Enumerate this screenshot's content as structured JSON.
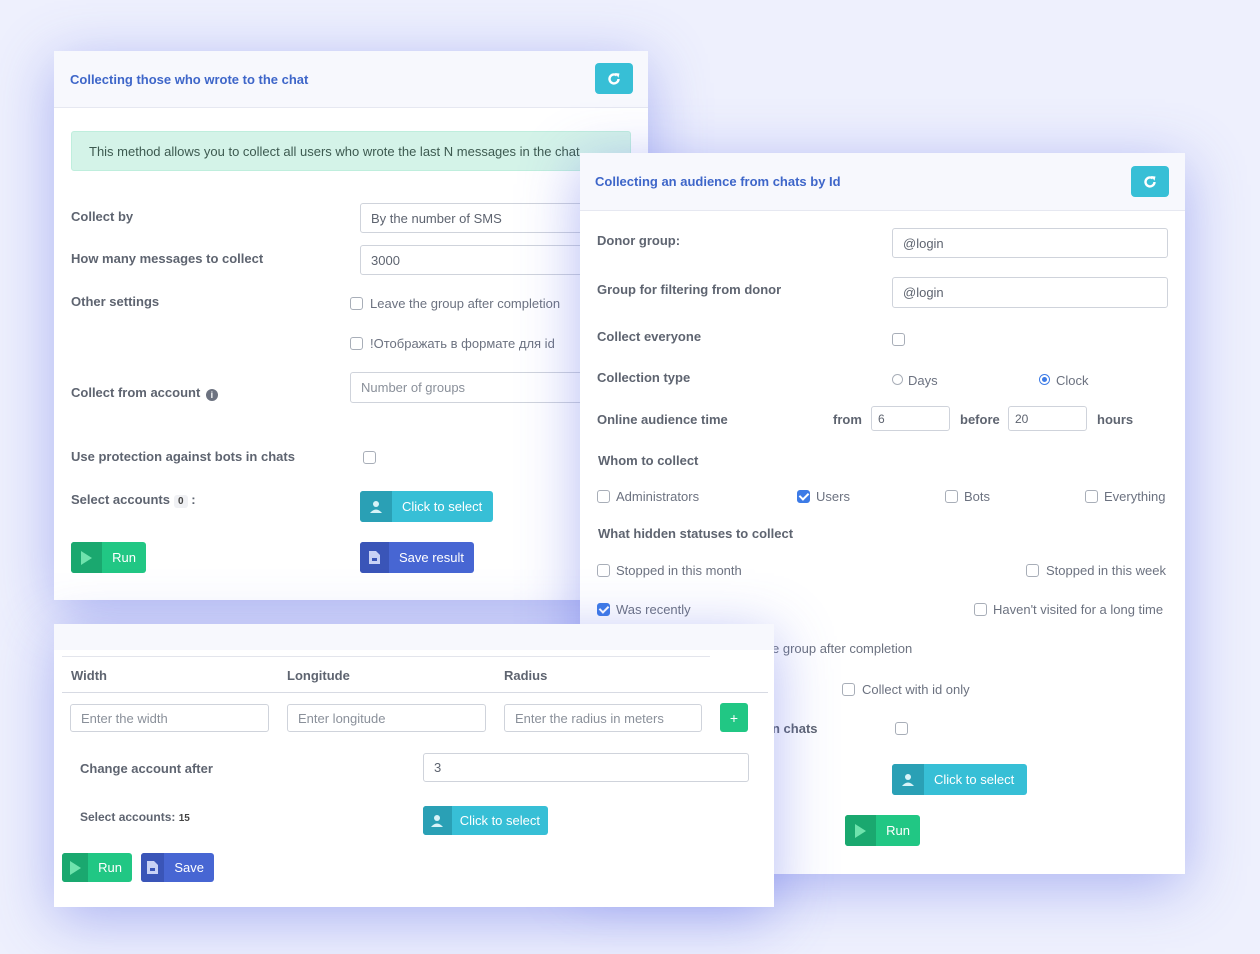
{
  "card1": {
    "title": "Collecting those who wrote to the chat",
    "alert": "This method allows you to collect all users who wrote the last N messages in the chat",
    "collect_by_label": "Collect by",
    "collect_by_value": "By the number of SMS",
    "how_many_label": "How many messages to collect",
    "how_many_value": "3000",
    "other_settings_label": "Other settings",
    "option_leave_group": "Leave the group after completion",
    "option_id_format": "!Отображать в формате для id",
    "collect_from_label": "Collect from account",
    "collect_from_placeholder": "Number of groups",
    "bot_protection_label": "Use protection against bots in chats",
    "select_accounts_label": "Select accounts",
    "select_accounts_count": "0",
    "select_accounts_colon": ":",
    "click_to_select": "Click to select",
    "run": "Run",
    "save_result": "Save result"
  },
  "card2": {
    "title": "Collecting an audience from chats by Id",
    "donor_group_label": "Donor group:",
    "donor_group_value": "@login",
    "filter_group_label": "Group for filtering from donor",
    "filter_group_value": "@login",
    "collect_everyone_label": "Collect everyone",
    "collection_type_label": "Collection type",
    "type_days": "Days",
    "type_clock": "Clock",
    "online_time_label": "Online audience time",
    "from_label": "from",
    "from_value": "6",
    "before_label": "before",
    "before_value": "20",
    "hours_label": "hours",
    "whom_label": "Whom to collect",
    "whom_admins": "Administrators",
    "whom_users": "Users",
    "whom_bots": "Bots",
    "whom_everything": "Everything",
    "hidden_label": "What hidden statuses to collect",
    "status_month": "Stopped in this month",
    "status_week": "Stopped in this week",
    "status_recently": "Was recently",
    "status_long": "Haven't visited for a long time",
    "partial_leave": "e group after completion",
    "collect_with_id": "Collect with id only",
    "partial_chats": "n chats",
    "click_to_select": "Click to select",
    "run": "Run"
  },
  "card3": {
    "col_width": "Width",
    "col_longitude": "Longitude",
    "col_radius": "Radius",
    "width_placeholder": "Enter the width",
    "longitude_placeholder": "Enter longitude",
    "radius_placeholder": "Enter the radius in meters",
    "add": "+",
    "change_account_label": "Change account after",
    "change_account_value": "3",
    "select_accounts_label": "Select accounts:",
    "select_accounts_count": "15",
    "click_to_select": "Click to select",
    "run": "Run",
    "save": "Save"
  },
  "colors": {
    "background": "#eef0fd",
    "title": "#3e66c9",
    "green": "#21c784",
    "cyan": "#37bfd6",
    "blue": "#4766d3",
    "alert": "#d4f3e8"
  },
  "icons": [
    "refresh-icon",
    "info-icon",
    "user-icon",
    "play-icon",
    "file-icon"
  ]
}
